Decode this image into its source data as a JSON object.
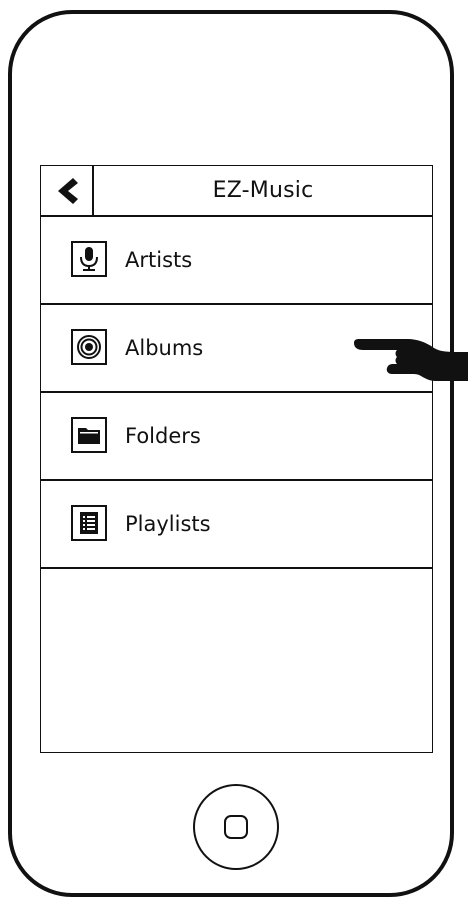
{
  "app": {
    "title": "EZ-Music"
  },
  "navigation": {
    "back_icon": "chevron-left-icon"
  },
  "menu": {
    "items": [
      {
        "label": "Artists",
        "icon": "microphone-icon"
      },
      {
        "label": "Albums",
        "icon": "album-icon"
      },
      {
        "label": "Folders",
        "icon": "folder-icon"
      },
      {
        "label": "Playlists",
        "icon": "list-icon"
      }
    ]
  },
  "annotation": {
    "pointer_icon": "pointing-hand-icon",
    "target": "Albums"
  },
  "device": {
    "home_icon": "home-button-icon"
  },
  "colors": {
    "stroke": "#111111",
    "background": "#ffffff"
  }
}
